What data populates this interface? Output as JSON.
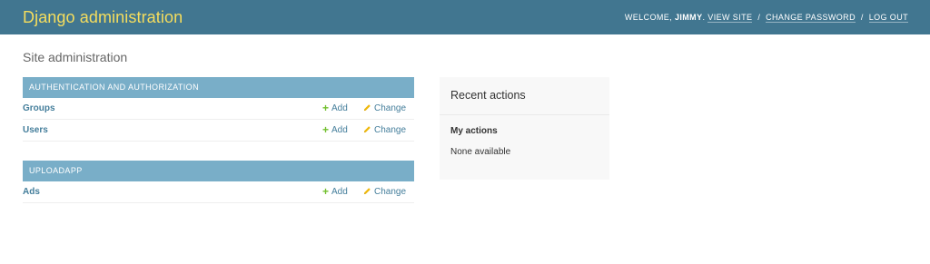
{
  "header": {
    "branding": "Django administration",
    "welcome": "WELCOME,",
    "username": "JIMMY",
    "view_site": "VIEW SITE",
    "change_password": "CHANGE PASSWORD",
    "log_out": "LOG OUT",
    "separator": "/"
  },
  "page": {
    "title": "Site administration"
  },
  "apps": [
    {
      "name": "AUTHENTICATION AND AUTHORIZATION",
      "models": [
        {
          "name": "Groups",
          "add": "Add",
          "change": "Change"
        },
        {
          "name": "Users",
          "add": "Add",
          "change": "Change"
        }
      ]
    },
    {
      "name": "UPLOADAPP",
      "models": [
        {
          "name": "Ads",
          "add": "Add",
          "change": "Change"
        }
      ]
    }
  ],
  "recent_actions": {
    "title": "Recent actions",
    "my_actions": "My actions",
    "empty": "None available"
  },
  "colors": {
    "header_bg": "#417690",
    "branding": "#f5dd5d",
    "module_header": "#79aec8",
    "link": "#447e9b",
    "add_icon": "#70bf2b",
    "change_icon": "#efb80b"
  },
  "icons": {
    "add": "plus-icon",
    "change": "pencil-icon"
  }
}
